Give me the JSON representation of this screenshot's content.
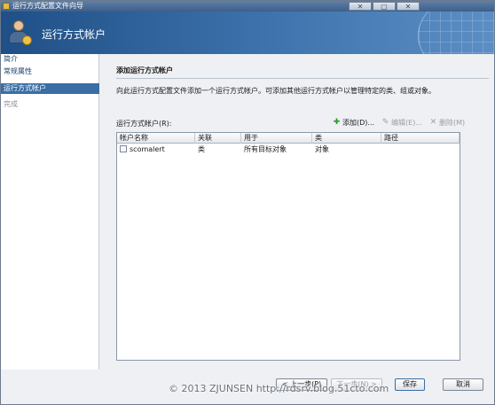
{
  "window": {
    "title": "运行方式配置文件向导",
    "controls": [
      "✕",
      "▢",
      "✕"
    ]
  },
  "banner": {
    "title": "运行方式帐户"
  },
  "nav": {
    "items": [
      {
        "label": "简介",
        "state": "normal"
      },
      {
        "label": "常规属性",
        "state": "normal"
      },
      {
        "label": "运行方式帐户",
        "state": "active"
      },
      {
        "label": "完成",
        "state": "disabled"
      }
    ]
  },
  "main": {
    "section_title": "添加运行方式帐户",
    "description": "向此运行方式配置文件添加一个运行方式帐户。可添加其他运行方式帐户以管理特定的类、组或对象。",
    "list_label": "运行方式帐户(R):",
    "toolbar": {
      "add_label": "添加(D)...",
      "edit_label": "编辑(E)...",
      "delete_label": "删除(M)"
    },
    "columns": [
      "帐户名称",
      "关联",
      "用于",
      "类",
      "路径"
    ],
    "rows": [
      {
        "account": "scomalert",
        "association": "类",
        "used_for": "所有目标对象",
        "class": "对象",
        "path": ""
      }
    ]
  },
  "footer": {
    "back_label": "< 上一步(P)",
    "next_label": "下一步(N) >",
    "save_label": "保存",
    "cancel_label": "取消"
  },
  "watermark": "© 2013 ZJUNSEN http://rdsrv.blog.51cto.com",
  "colors": {
    "accent": "#3a6ea5",
    "banner_start": "#1f4f86",
    "banner_end": "#5b8ec4",
    "add_icon": "#2b9a2b"
  },
  "icons": {
    "app": "wizard-icon",
    "banner": "user-account-icon",
    "add": "plus-icon",
    "edit": "pencil-icon",
    "delete": "x-icon",
    "row": "account-row-icon"
  }
}
